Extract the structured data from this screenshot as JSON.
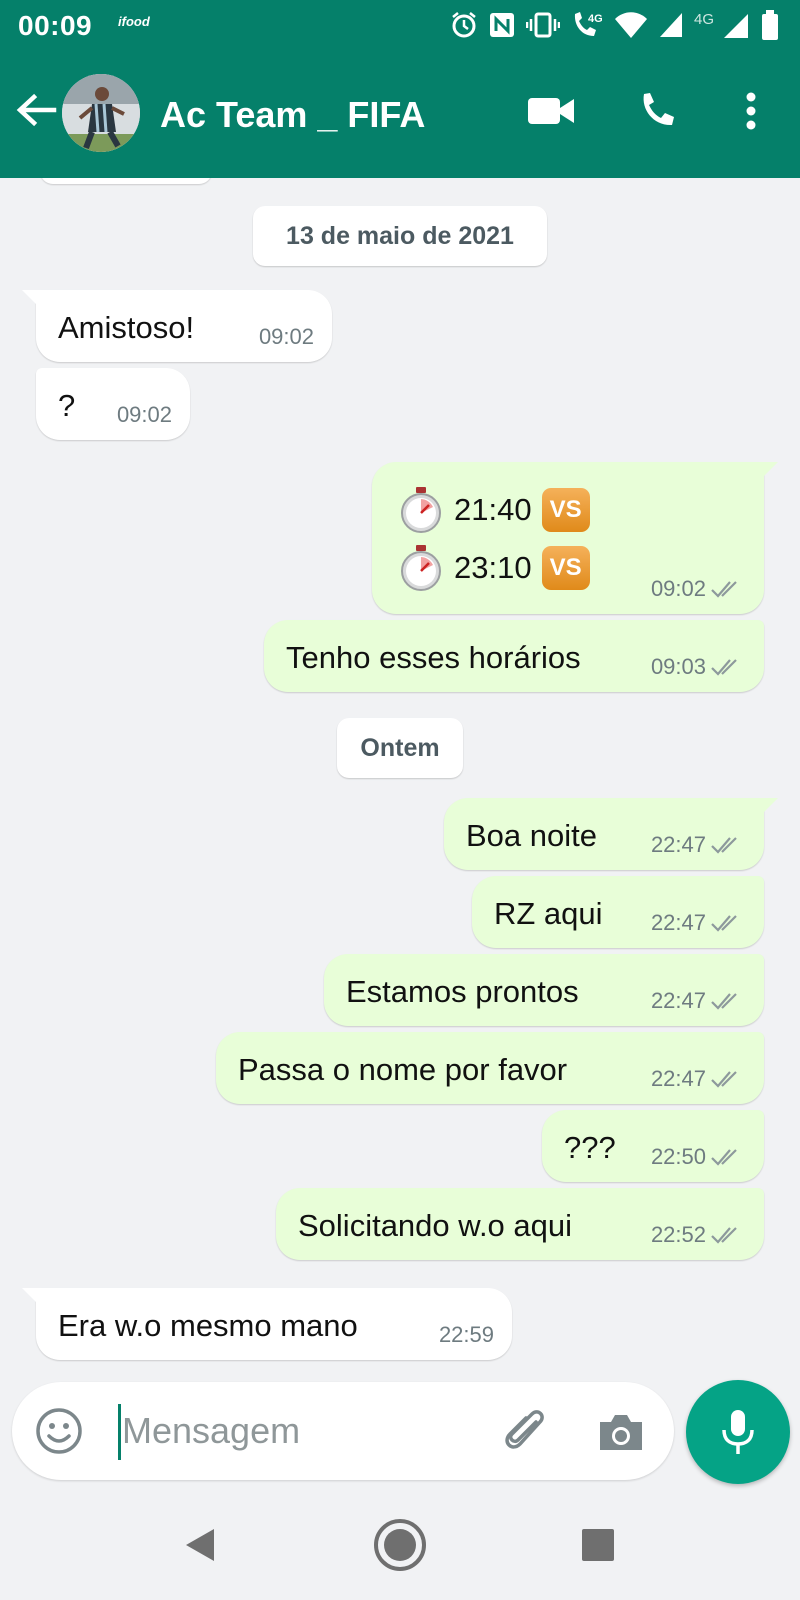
{
  "status_bar": {
    "time": "00:09",
    "app_badge": "ifood",
    "icons": [
      "alarm-icon",
      "nfc-icon",
      "vibrate-icon",
      "wifi-call-4g-icon",
      "wifi-icon",
      "signal-icon",
      "signal-4g-icon",
      "battery-icon"
    ],
    "net_label_1": "4G",
    "net_label_2": "4G"
  },
  "header": {
    "title": "Ac Team _ FIFA",
    "avatar_icon": "contact-avatar-photo",
    "actions": [
      "video-call-icon",
      "voice-call-icon",
      "more-options-icon"
    ]
  },
  "chat": {
    "date_chips": [
      "13 de maio de 2021",
      "Ontem"
    ],
    "messages": [
      {
        "direction": "in",
        "text": "Amistoso!",
        "time": "09:02"
      },
      {
        "direction": "in",
        "text": "?",
        "time": "09:02"
      },
      {
        "direction": "out",
        "lines": [
          {
            "text": "21:40",
            "emoji": "VS"
          },
          {
            "text": "23:10",
            "emoji": "VS"
          }
        ],
        "time": "09:02",
        "read": true
      },
      {
        "direction": "out",
        "text": "Tenho esses horários",
        "time": "09:03",
        "read": true
      },
      {
        "direction": "out",
        "text": "Boa noite",
        "time": "22:47",
        "read": true
      },
      {
        "direction": "out",
        "text": "RZ aqui",
        "time": "22:47",
        "read": true
      },
      {
        "direction": "out",
        "text": "Estamos prontos",
        "time": "22:47",
        "read": true
      },
      {
        "direction": "out",
        "text": "Passa o nome por favor",
        "time": "22:47",
        "read": true
      },
      {
        "direction": "out",
        "text": "???",
        "time": "22:50",
        "read": true
      },
      {
        "direction": "out",
        "text": "Solicitando w.o aqui",
        "time": "22:52",
        "read": true
      },
      {
        "direction": "in",
        "text": "Era w.o mesmo mano",
        "time": "22:59"
      }
    ]
  },
  "composer": {
    "placeholder": "Mensagem",
    "value": "",
    "icons": [
      "emoji-icon",
      "attach-icon",
      "camera-icon",
      "mic-icon"
    ]
  },
  "nav": {
    "icons": [
      "back-triangle-icon",
      "home-circle-icon",
      "recents-square-icon"
    ]
  },
  "colors": {
    "header_green": "#05806a",
    "mic_green": "#05a386",
    "outgoing_bubble": "#e8fed8",
    "incoming_bubble": "#ffffff",
    "chat_background": "#f1f2f4"
  }
}
